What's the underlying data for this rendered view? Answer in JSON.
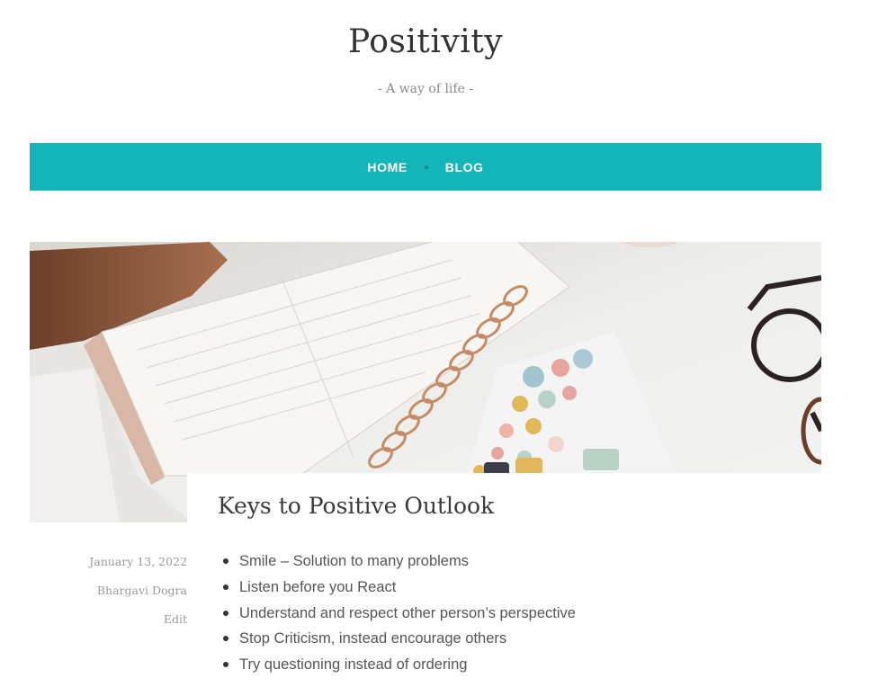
{
  "site": {
    "title": "Positivity",
    "tagline": "- A way of life -"
  },
  "nav": {
    "items": [
      "HOME",
      "BLOG"
    ],
    "background_color": "#13b5b9"
  },
  "post": {
    "title": "Keys to Positive Outlook",
    "date": "January 13, 2022",
    "author": "Bhargavi Dogra",
    "edit_label": "Edit",
    "list": [
      "Smile – Solution to many problems",
      "Listen before you React",
      "Understand and respect other person’s perspective",
      "Stop Criticism, instead encourage others",
      "Try questioning instead of ordering"
    ]
  },
  "hero_image": {
    "description_icon": "planner-notebook-photo"
  }
}
